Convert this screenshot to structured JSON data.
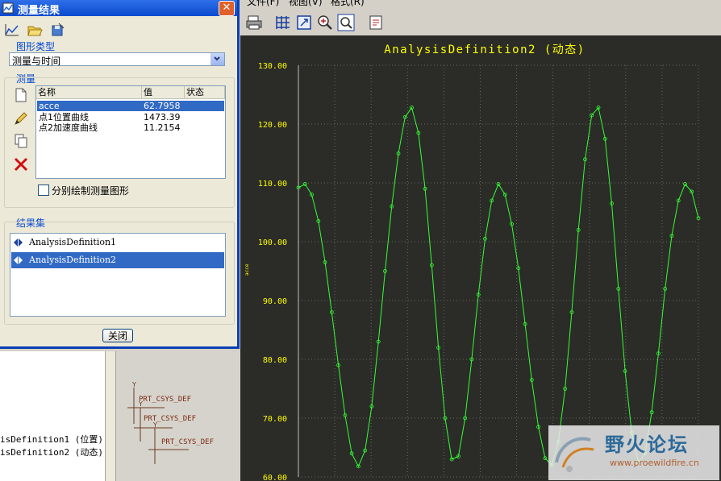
{
  "dialog": {
    "title": "测量结果",
    "close_glyph": "✕",
    "graph_type_label": "图形类型",
    "graph_type_value": "测量与时间",
    "measure_label": "测量",
    "columns": [
      "名称",
      "值",
      "状态"
    ],
    "measures": [
      {
        "name": "acce",
        "value": "62.7958",
        "status": ""
      },
      {
        "name": "点1位置曲线",
        "value": "1473.39",
        "status": ""
      },
      {
        "name": "点2加速度曲线",
        "value": "11.2154",
        "status": ""
      }
    ],
    "separate_checkbox_label": "分别绘制测量图形",
    "result_set_label": "结果集",
    "result_sets": [
      "AnalysisDefinition1",
      "AnalysisDefinition2"
    ],
    "close_button": "关闭"
  },
  "model_tree": {
    "items": [
      "isDefinition1 (位置)",
      "isDefinition2 (动态)"
    ]
  },
  "model_view": {
    "labels": [
      "PRT_CSYS_DEF",
      "PRT_CSYS_DEF",
      "PRT_CSYS_DEF"
    ]
  },
  "graph_window": {
    "menus": [
      "文件(F)",
      "视图(V)",
      "格式(R)"
    ],
    "toolbar_icons": [
      "print-icon",
      "grid-icon",
      "zoom-fit-icon",
      "zoom-in-icon",
      "zoom-window-icon",
      "export-icon"
    ]
  },
  "watermark": {
    "title": "野火论坛",
    "url": "www.proewildfire.cn"
  },
  "chart_data": {
    "type": "line",
    "title": "AnalysisDefinition2 (动态)",
    "ylabel": "acce",
    "xlabel": "",
    "ylim": [
      60,
      130
    ],
    "yticks": [
      "130.00",
      "120.00",
      "110.00",
      "100.00",
      "90.00",
      "80.00",
      "70.00",
      "60.00"
    ],
    "grid": true,
    "series_color": "#33ff33",
    "background": "#2b2b28",
    "series": [
      {
        "name": "acce",
        "x": [
          0,
          0.25,
          0.5,
          0.75,
          1,
          1.25,
          1.5,
          1.75,
          2,
          2.25,
          2.5,
          2.75,
          3,
          3.25,
          3.5,
          3.75,
          4,
          4.25,
          4.5,
          4.75,
          5,
          5.25,
          5.5,
          5.75,
          6,
          6.25,
          6.5,
          6.75,
          7,
          7.25,
          7.5,
          7.75,
          8,
          8.25,
          8.5,
          8.75,
          9,
          9.25,
          9.5,
          9.75,
          10,
          10.25,
          10.5,
          10.75,
          11,
          11.25,
          11.5,
          11.75,
          12,
          12.25,
          12.5,
          12.75,
          13,
          13.25,
          13.5,
          13.75,
          14,
          14.25,
          14.5,
          14.75,
          15
        ],
        "y": [
          109.2,
          109.8,
          108.0,
          103.5,
          96.5,
          88.0,
          79.0,
          70.5,
          64.0,
          61.8,
          64.5,
          72.0,
          83.0,
          95.0,
          106.0,
          115.0,
          121.2,
          122.8,
          118.5,
          109.0,
          96.0,
          82.0,
          70.0,
          63.0,
          63.5,
          70.0,
          80.0,
          91.0,
          100.5,
          107.0,
          109.8,
          108.0,
          103.0,
          95.5,
          86.0,
          76.5,
          68.5,
          63.2,
          62.0,
          66.0,
          75.0,
          88.0,
          102.0,
          114.0,
          121.5,
          122.8,
          117.5,
          106.5,
          92.0,
          78.0,
          67.5,
          62.5,
          64.0,
          71.0,
          81.0,
          92.0,
          101.0,
          107.0,
          109.8,
          108.5,
          104.0
        ]
      }
    ]
  }
}
